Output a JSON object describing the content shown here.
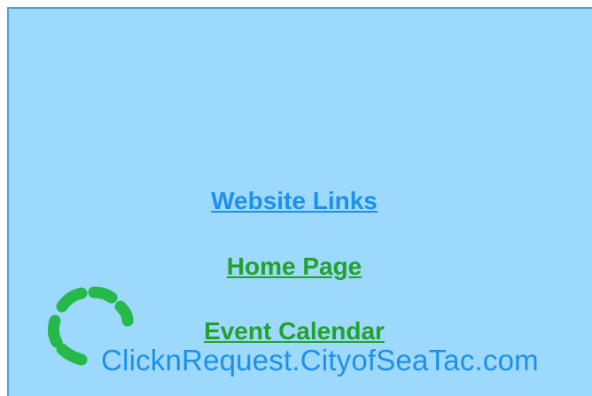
{
  "links": {
    "website_links": "Website Links",
    "home_page": "Home Page",
    "event_calendar": "Event Calendar"
  },
  "logo": {
    "text": "ClicknRequest.CityofSeaTac.com"
  },
  "colors": {
    "panel_background": "#9dd8fd",
    "panel_border": "#4a9fd8",
    "heading_link": "#1e90e8",
    "nav_link": "#22a22a",
    "logo_ring": "#27b84a",
    "logo_text": "#1e90e8"
  }
}
